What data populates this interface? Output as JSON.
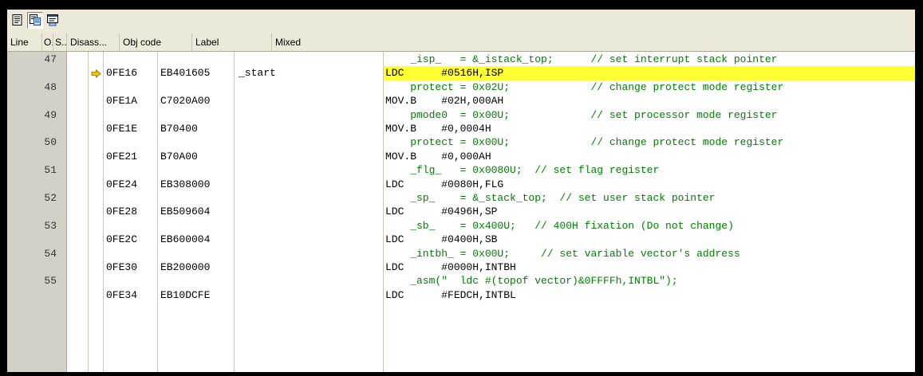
{
  "toolbar": {
    "buttons": [
      {
        "name": "source-view-icon",
        "pressed": false
      },
      {
        "name": "disassembly-view-icon",
        "pressed": true
      },
      {
        "name": "mixed-view-icon",
        "pressed": false
      }
    ]
  },
  "columns": [
    "Line",
    "O..",
    "S..",
    "Disass...",
    "Obj code",
    "Label",
    "Mixed"
  ],
  "rows": [
    {
      "line": "47",
      "source": "    _isp_   = &_istack_top;      // set interrupt stack pointer",
      "addr": "0FE16",
      "obj": "EB401605",
      "label": "_start",
      "asm": "LDC      #0516H,ISP",
      "current": true
    },
    {
      "line": "48",
      "source": "    protect = 0x02U;             // change protect mode register",
      "addr": "0FE1A",
      "obj": "C7020A00",
      "label": "",
      "asm": "MOV.B    #02H,000AH",
      "current": false
    },
    {
      "line": "49",
      "source": "    pmode0  = 0x00U;             // set processor mode register",
      "addr": "0FE1E",
      "obj": "B70400",
      "label": "",
      "asm": "MOV.B    #0,0004H",
      "current": false
    },
    {
      "line": "50",
      "source": "    protect = 0x00U;             // change protect mode register",
      "addr": "0FE21",
      "obj": "B70A00",
      "label": "",
      "asm": "MOV.B    #0,000AH",
      "current": false
    },
    {
      "line": "51",
      "source": "    _flg_   = 0x0080U;  // set flag register",
      "addr": "0FE24",
      "obj": "EB308000",
      "label": "",
      "asm": "LDC      #0080H,FLG",
      "current": false
    },
    {
      "line": "52",
      "source": "    _sp_    = &_stack_top;  // set user stack pointer",
      "addr": "0FE28",
      "obj": "EB509604",
      "label": "",
      "asm": "LDC      #0496H,SP",
      "current": false
    },
    {
      "line": "53",
      "source": "    _sb_    = 0x400U;   // 400H fixation (Do not change)",
      "addr": "0FE2C",
      "obj": "EB600004",
      "label": "",
      "asm": "LDC      #0400H,SB",
      "current": false
    },
    {
      "line": "54",
      "source": "    _intbh_ = 0x00U;     // set variable vector's address",
      "addr": "0FE30",
      "obj": "EB200000",
      "label": "",
      "asm": "LDC      #0000H,INTBH",
      "current": false
    },
    {
      "line": "55",
      "source": "    _asm(\"  ldc #(topof vector)&0FFFFh,INTBL\");",
      "addr": "0FE34",
      "obj": "EB10DCFE",
      "label": "",
      "asm": "LDC      #FEDCH,INTBL",
      "current": false
    }
  ],
  "colors": {
    "highlight": "#ffff33",
    "source_text": "#008000",
    "arrow": "#f5c400"
  }
}
